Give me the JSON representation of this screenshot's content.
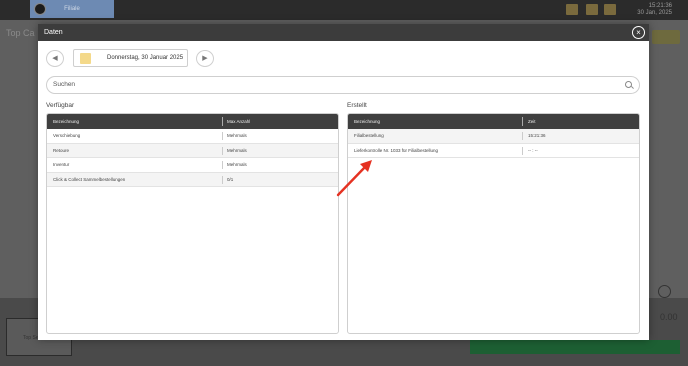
{
  "background": {
    "tab_label": "Filiale",
    "clock_time": "15:21:36",
    "clock_date": "30 Jan, 2025",
    "page_title": "Top Ca",
    "card_label": "Top Se",
    "price": "0.00"
  },
  "modal": {
    "title": "Daten",
    "date_label": "Donnerstag, 30 Januar 2025",
    "prev_icon": "chevron-left-icon",
    "next_icon": "chevron-right-icon",
    "close_icon": "close-icon",
    "search": {
      "placeholder": "Suchen"
    },
    "available": {
      "title": "Verfügbar",
      "columns": [
        "Bezeichnung",
        "Max Anzahl"
      ],
      "rows": [
        [
          "Verschiebung",
          "Mehrmals"
        ],
        [
          "Retoure",
          "Mehrmals"
        ],
        [
          "Inventur",
          "Mehrmals"
        ],
        [
          "Click & Collect Sammelbestellungen",
          "0/1"
        ]
      ]
    },
    "created": {
      "title": "Erstellt",
      "columns": [
        "Bezeichnung",
        "Zeit"
      ],
      "rows": [
        [
          "Filialbestellung",
          "15:21:36"
        ],
        [
          "Lieferkontrolle Nr. 1033 für Filialbestellung",
          "-- : --"
        ]
      ]
    }
  },
  "colors": {
    "header": "#3c3c3c",
    "table_header": "#3f3f3f",
    "annotation_arrow": "#e53222",
    "calendar_icon": "#f4d98a"
  }
}
